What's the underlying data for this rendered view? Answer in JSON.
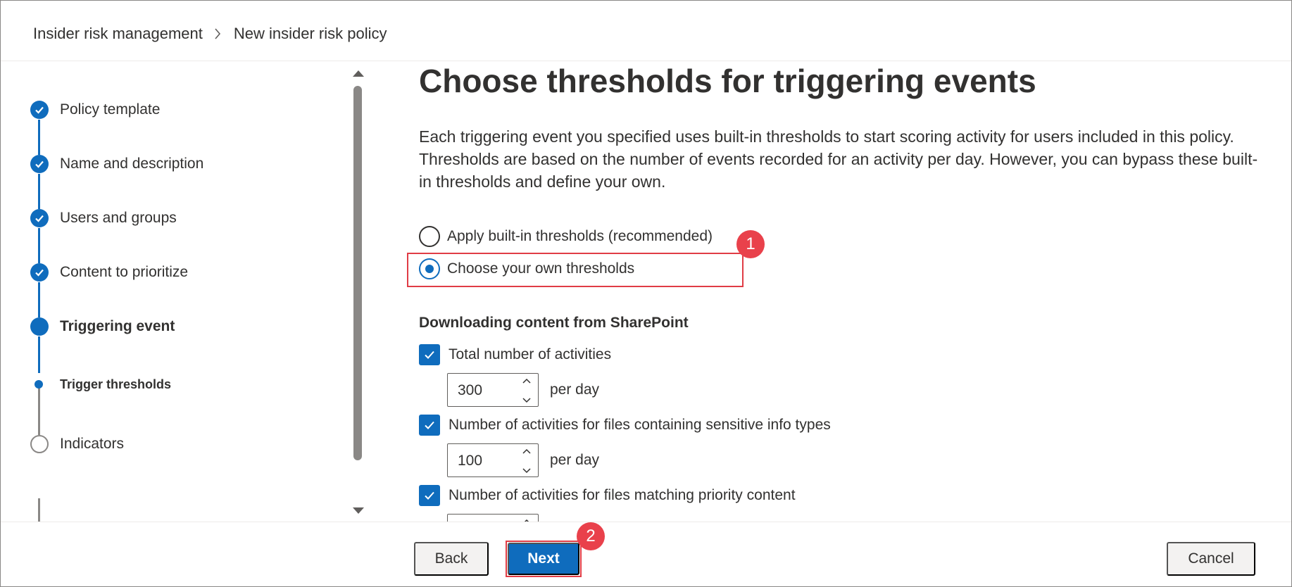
{
  "breadcrumb": {
    "items": [
      "Insider risk management",
      "New insider risk policy"
    ]
  },
  "stepper": {
    "steps": [
      {
        "label": "Policy template",
        "state": "done"
      },
      {
        "label": "Name and description",
        "state": "done"
      },
      {
        "label": "Users and groups",
        "state": "done"
      },
      {
        "label": "Content to prioritize",
        "state": "done"
      },
      {
        "label": "Triggering event",
        "state": "current"
      },
      {
        "label": "Trigger thresholds",
        "state": "current-substep"
      },
      {
        "label": "Indicators",
        "state": "todo"
      }
    ]
  },
  "main": {
    "title": "Choose thresholds for triggering events",
    "description": "Each triggering event you specified uses built-in thresholds to start scoring activity for users included in this policy. Thresholds are based on the number of events recorded for an activity per day. However, you can bypass these built-in thresholds and define your own.",
    "options": [
      {
        "label": "Apply built-in thresholds (recommended)",
        "selected": false
      },
      {
        "label": "Choose your own thresholds",
        "selected": true
      }
    ],
    "section_title": "Downloading content from SharePoint",
    "thresholds": [
      {
        "label": "Total number of activities",
        "checked": true,
        "value": "300",
        "unit": "per day"
      },
      {
        "label": "Number of activities for files containing sensitive info types",
        "checked": true,
        "value": "100",
        "unit": "per day"
      },
      {
        "label": "Number of activities for files matching priority content",
        "checked": true,
        "value": "",
        "unit": ""
      }
    ]
  },
  "annotations": {
    "badge_1": "1",
    "badge_2": "2",
    "badge_color": "#e9414b"
  },
  "footer": {
    "back_label": "Back",
    "next_label": "Next",
    "cancel_label": "Cancel"
  },
  "colors": {
    "accent": "#0f6cbd",
    "text": "#323130",
    "highlight": "#e03c45"
  }
}
